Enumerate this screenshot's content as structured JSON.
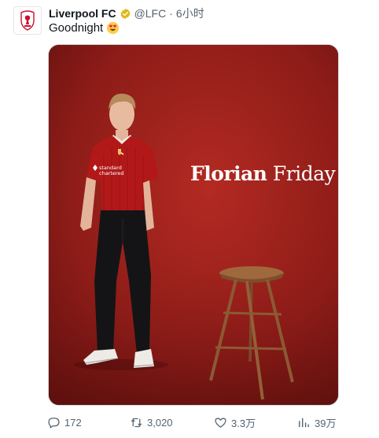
{
  "tweet": {
    "author_name": "Liverpool FC",
    "handle": "@LFC",
    "separator": "·",
    "time": "6小时",
    "text": "Goodnight",
    "text_emoji": "heart-eyes-emoji",
    "image": {
      "overlay_word1": "Florian",
      "overlay_word2": "Friday",
      "shirt_sponsor_line1": "standard",
      "shirt_sponsor_line2": "chartered"
    },
    "stats": {
      "replies": "172",
      "retweets": "3,020",
      "likes": "3.3万",
      "views": "39万"
    }
  },
  "colors": {
    "text_primary": "#0f1419",
    "text_secondary": "#536471",
    "verified_gold": "#e2b719",
    "lfc_red": "#c8102e",
    "backdrop_red": "#8a1a18"
  },
  "icons": [
    "lfc-crest-icon",
    "verified-badge-icon",
    "reply-icon",
    "retweet-icon",
    "like-icon",
    "views-icon"
  ]
}
